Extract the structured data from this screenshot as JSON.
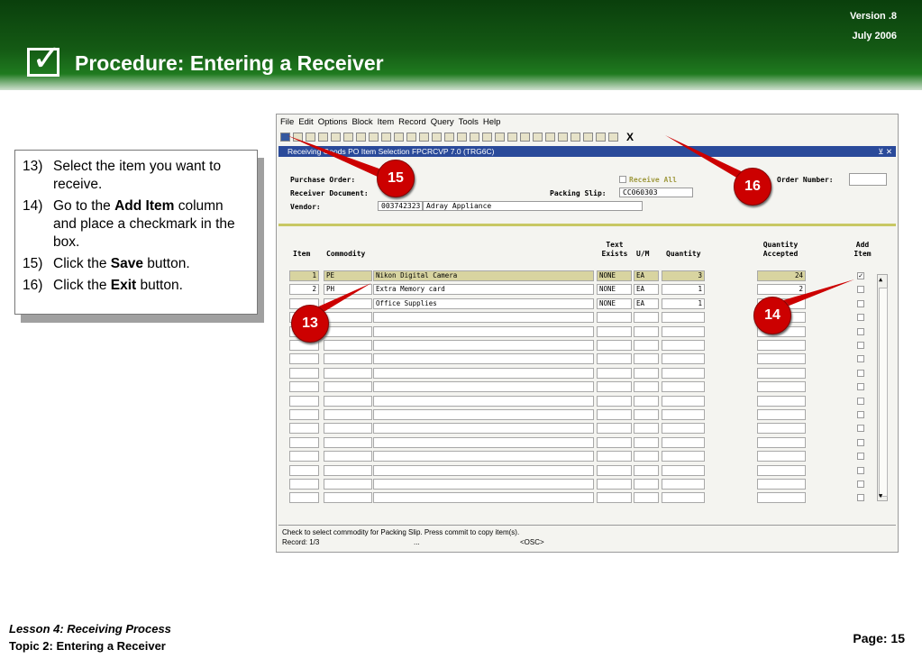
{
  "header": {
    "version": "Version .8",
    "date": "July  2006",
    "title": "Procedure: Entering a Receiver",
    "check_glyph": "✓"
  },
  "steps": [
    {
      "num": "13)",
      "pre": "Select the item you want to receive.",
      "bold": "",
      "post": ""
    },
    {
      "num": "14)",
      "pre": "Go to the ",
      "bold": "Add Item",
      "post": " column and place a checkmark in the box."
    },
    {
      "num": "15)",
      "pre": "Click the ",
      "bold": "Save",
      "post": " button."
    },
    {
      "num": "16)",
      "pre": "Click the ",
      "bold": "Exit",
      "post": " button."
    }
  ],
  "app": {
    "menu": [
      "File",
      "Edit",
      "Options",
      "Block",
      "Item",
      "Record",
      "Query",
      "Tools",
      "Help"
    ],
    "exit_label": "X",
    "window_title": "Receiving Goods PO Item Selection  FPCRCVP  7.0  (TRG6C)",
    "window_controls": "⊻ ✕",
    "labels": {
      "po": "Purchase Order:",
      "receiver": "Receiver Document:",
      "vendor": "Vendor:",
      "receive_all": "Receive All",
      "order_number": "Order Number:",
      "packing_slip": "Packing Slip:"
    },
    "values": {
      "vendor_id": "003742323",
      "vendor_name": "Adray Appliance",
      "packing_slip": "CC060303"
    },
    "columns": {
      "item": "Item",
      "commodity": "Commodity",
      "text_exists_1": "Text",
      "text_exists_2": "Exists",
      "um": "U/M",
      "quantity": "Quantity",
      "qty_acc_1": "Quantity",
      "qty_acc_2": "Accepted",
      "add_1": "Add",
      "add_2": "Item"
    },
    "rows": [
      {
        "item": "1",
        "code": "PE",
        "desc": "Nikon Digital Camera",
        "text": "NONE",
        "um": "EA",
        "qty": "3",
        "accepted": "24",
        "checked": "✓"
      },
      {
        "item": "2",
        "code": "PH",
        "desc": "Extra Memory card",
        "text": "NONE",
        "um": "EA",
        "qty": "1",
        "accepted": "2",
        "checked": ""
      },
      {
        "item": "",
        "code": "",
        "desc": "Office Supplies",
        "text": "NONE",
        "um": "EA",
        "qty": "1",
        "accepted": "",
        "checked": ""
      }
    ],
    "status_msg": "Check to select commodity for Packing Slip. Press commit to copy item(s).",
    "record": "Record: 1/3",
    "record_dots": "...",
    "osc": "<OSC>"
  },
  "callouts": {
    "c15": "15",
    "c16": "16",
    "c13": "13",
    "c14": "14"
  },
  "footer": {
    "lesson": "Lesson 4: Receiving Process",
    "topic": "Topic 2: Entering a Receiver",
    "page": "Page: 15"
  }
}
